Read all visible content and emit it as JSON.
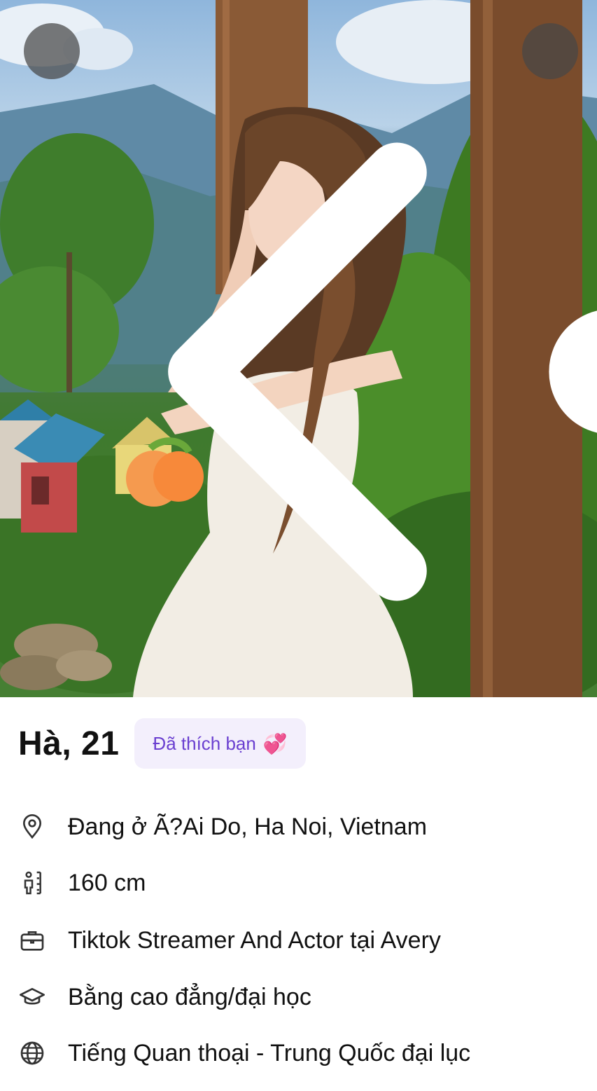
{
  "header": {
    "back_icon": "chevron-left-icon",
    "more_icon": "more-horizontal-icon"
  },
  "profile": {
    "name_age": "Hà, 21",
    "liked_badge": "Đã thích bạn",
    "liked_emoji": "💞",
    "accent_color": "#6a3fd0",
    "badge_bg": "#f3effc"
  },
  "details": [
    {
      "icon": "location-pin-icon",
      "text": "Đang ở Ã?Ai Do, Ha Noi, Vietnam"
    },
    {
      "icon": "height-icon",
      "text": "160 cm"
    },
    {
      "icon": "briefcase-icon",
      "text": "Tiktok Streamer And Actor tại Avery"
    },
    {
      "icon": "graduation-cap-icon",
      "text": "Bằng cao đẳng/đại học"
    },
    {
      "icon": "globe-icon",
      "text": "Tiếng Quan thoại - Trung Quốc đại lục"
    }
  ]
}
